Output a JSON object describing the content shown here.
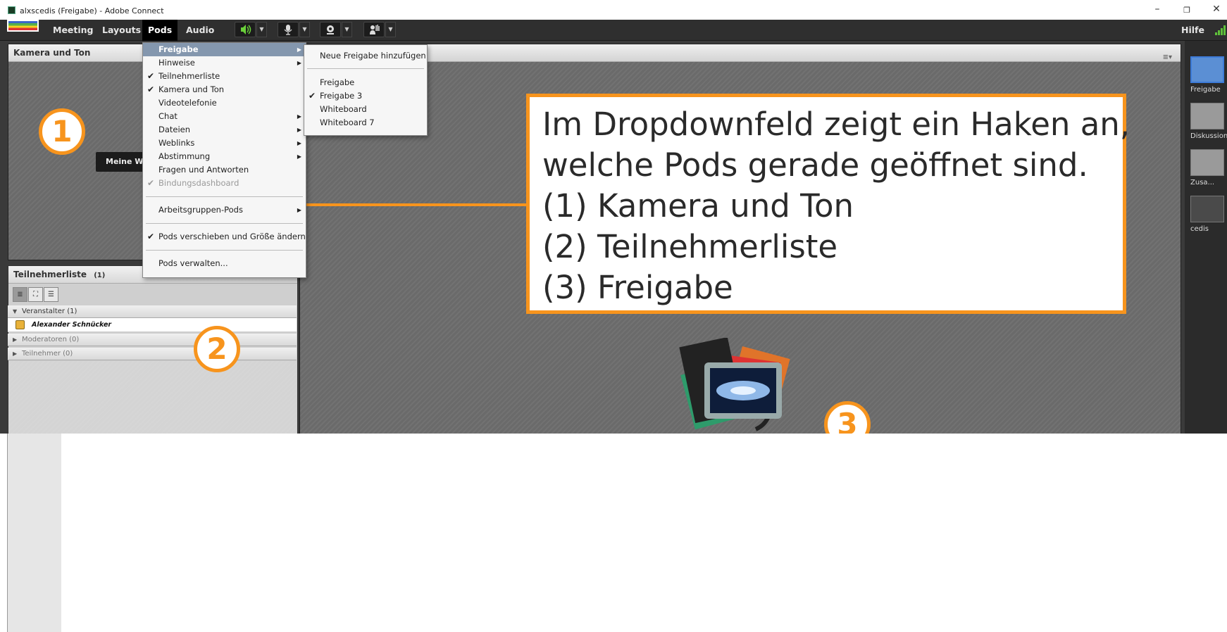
{
  "window": {
    "title": "alxscedis (Freigabe) - Adobe Connect",
    "controls": [
      "–",
      "❐",
      "✕"
    ]
  },
  "menubar": {
    "items": [
      "Meeting",
      "Layouts",
      "Pods",
      "Audio"
    ],
    "active": "Pods",
    "help": "Hilfe",
    "icons": [
      "speaker-icon",
      "microphone-icon",
      "webcam-icon",
      "raise-hand-icon",
      "signal-strength-icon"
    ]
  },
  "pods": {
    "camera": {
      "title": "Kamera und Ton",
      "button": "Meine W"
    },
    "attendees": {
      "title": "Teilnehmerliste",
      "count": "(1)",
      "groups": [
        {
          "label": "Veranstalter (1)",
          "expanded": true
        },
        {
          "label": "Moderatoren (0)",
          "expanded": false
        },
        {
          "label": "Teilnehmer (0)",
          "expanded": false
        }
      ],
      "users": [
        {
          "name": "Alexander Schnücker"
        }
      ]
    },
    "share": {
      "menu_icon": "≡▾"
    }
  },
  "dropdown": {
    "items": [
      {
        "label": "Freigabe",
        "checked": false,
        "submenu": true,
        "highlighted": true,
        "disabled": false
      },
      {
        "label": "Hinweise",
        "checked": false,
        "submenu": true,
        "highlighted": false,
        "disabled": false
      },
      {
        "label": "Teilnehmerliste",
        "checked": true,
        "submenu": false,
        "highlighted": false,
        "disabled": false
      },
      {
        "label": "Kamera und Ton",
        "checked": true,
        "submenu": false,
        "highlighted": false,
        "disabled": false
      },
      {
        "label": "Videotelefonie",
        "checked": false,
        "submenu": false,
        "highlighted": false,
        "disabled": false
      },
      {
        "label": "Chat",
        "checked": false,
        "submenu": true,
        "highlighted": false,
        "disabled": false
      },
      {
        "label": "Dateien",
        "checked": false,
        "submenu": true,
        "highlighted": false,
        "disabled": false
      },
      {
        "label": "Weblinks",
        "checked": false,
        "submenu": true,
        "highlighted": false,
        "disabled": false
      },
      {
        "label": "Abstimmung",
        "checked": false,
        "submenu": true,
        "highlighted": false,
        "disabled": false
      },
      {
        "label": "Fragen und Antworten",
        "checked": false,
        "submenu": false,
        "highlighted": false,
        "disabled": false
      },
      {
        "label": "Bindungsdashboard",
        "checked": true,
        "submenu": false,
        "highlighted": false,
        "disabled": true
      },
      {
        "label": "Arbeitsgruppen-Pods",
        "checked": false,
        "submenu": true,
        "highlighted": false,
        "disabled": false
      },
      {
        "label": "Pods verschieben und Größe ändern",
        "checked": true,
        "submenu": false,
        "highlighted": false,
        "disabled": false
      },
      {
        "label": "Pods verwalten...",
        "checked": false,
        "submenu": false,
        "highlighted": false,
        "disabled": false
      }
    ]
  },
  "submenu": {
    "items": [
      {
        "label": "Neue Freigabe hinzufügen",
        "checked": false
      },
      {
        "label": "Freigabe",
        "checked": false
      },
      {
        "label": "Freigabe 3",
        "checked": true
      },
      {
        "label": "Whiteboard",
        "checked": false
      },
      {
        "label": "Whiteboard 7",
        "checked": false
      }
    ]
  },
  "layouts": [
    {
      "label": "Freigabe",
      "selected": true
    },
    {
      "label": "Diskussion",
      "selected": false
    },
    {
      "label": "Zusa...",
      "selected": false
    },
    {
      "label": "cedis",
      "selected": false
    }
  ],
  "callout": {
    "lines": [
      "Im Dropdownfeld zeigt ein Haken an,",
      "welche Pods gerade geöffnet sind.",
      "(1)  Kamera und Ton",
      "(2)  Teilnehmerliste",
      "(3) Freigabe"
    ]
  },
  "badges": [
    "1",
    "2",
    "3"
  ],
  "colors": {
    "accent_orange": "#f7941d",
    "menu_highlight": "#8497ae",
    "menubar_bg": "#2f2f2f"
  }
}
